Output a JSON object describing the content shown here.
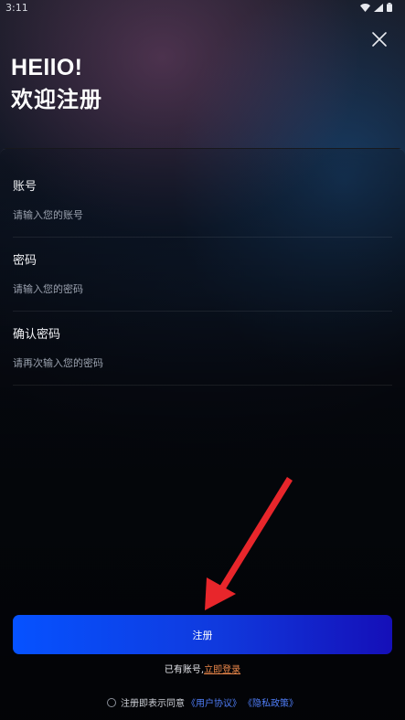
{
  "status_bar": {
    "time": "3:11",
    "icons": [
      "wifi-icon",
      "signal-icon",
      "battery-icon"
    ]
  },
  "header": {
    "greeting": "HEllO!",
    "title": "欢迎注册",
    "close_icon": "close-icon"
  },
  "form": {
    "fields": [
      {
        "label": "账号",
        "placeholder": "请输入您的账号"
      },
      {
        "label": "密码",
        "placeholder": "请输入您的密码"
      },
      {
        "label": "确认密码",
        "placeholder": "请再次输入您的密码"
      }
    ]
  },
  "actions": {
    "register_label": "注册",
    "login_prompt": "已有账号,",
    "login_link": "立即登录"
  },
  "agreement": {
    "prefix": "注册即表示同意",
    "user_agreement": "《用户协议》",
    "privacy_policy": "《隐私政策》"
  },
  "colors": {
    "accent_blue": "#0652ff",
    "accent_violet": "#150fb8",
    "link_orange": "#f08a4b",
    "link_blue": "#4f7df7",
    "annotation_red": "#e8262b"
  }
}
